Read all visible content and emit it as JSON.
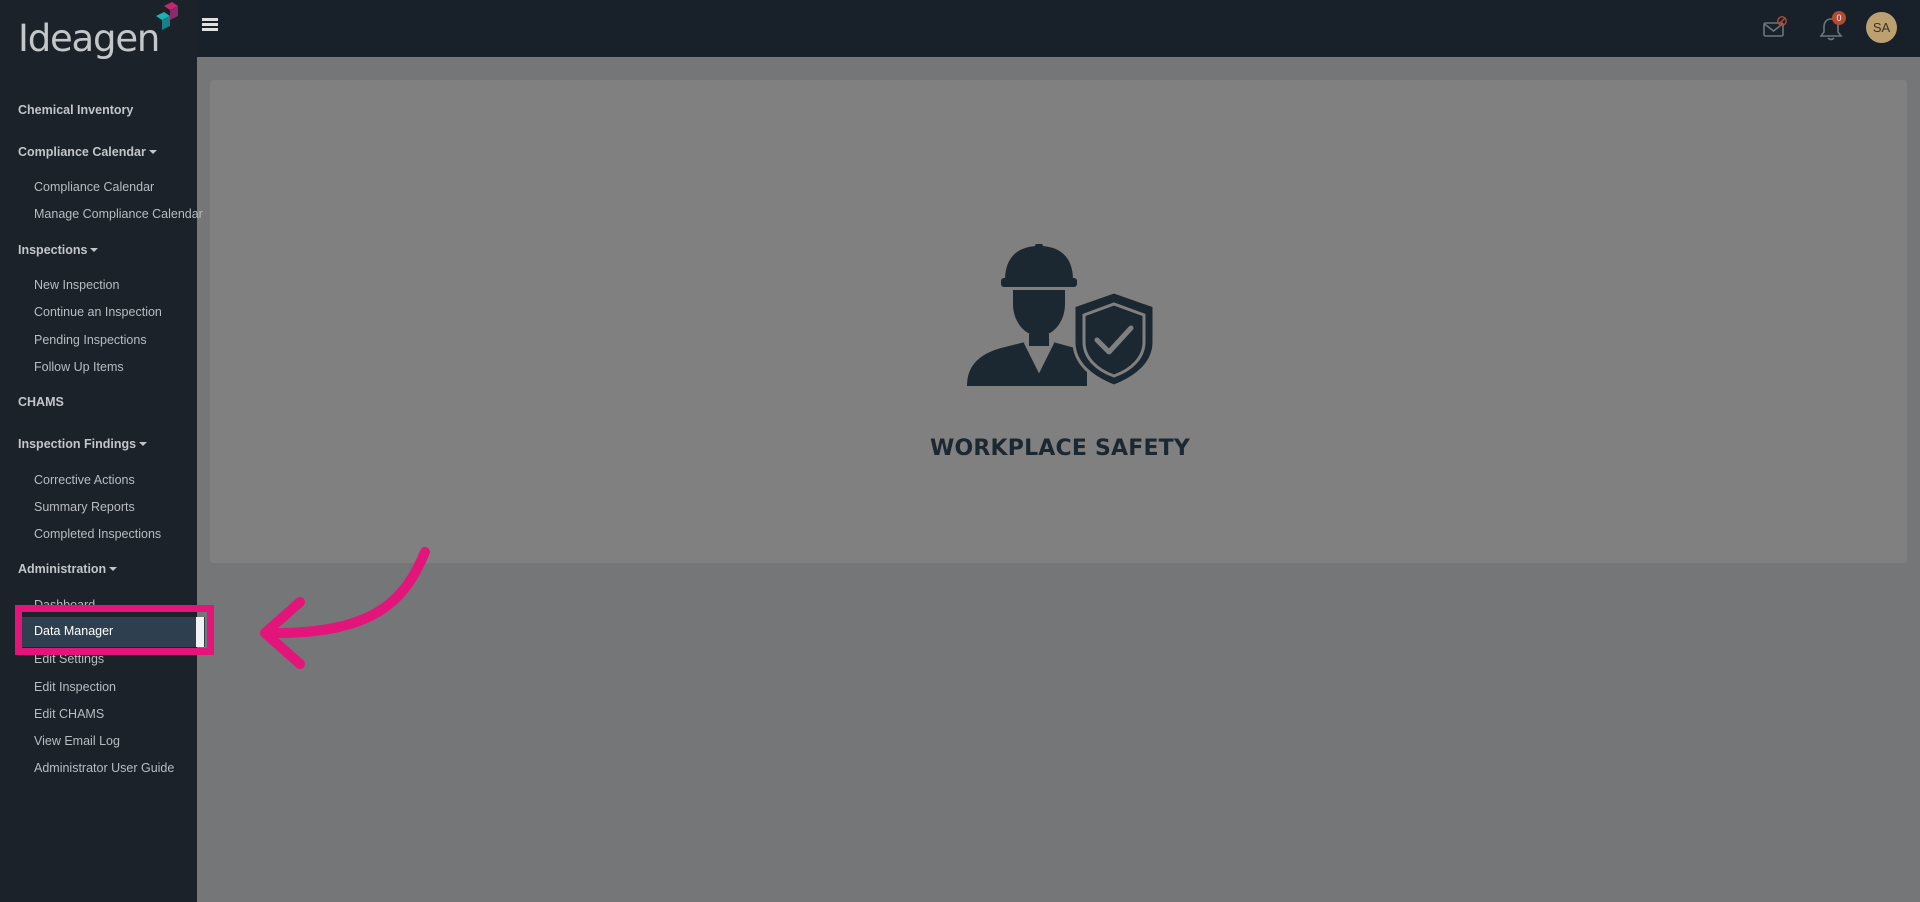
{
  "brand": {
    "logo_text": "Ideagen"
  },
  "sidebar": {
    "groups": [
      {
        "label": "Chemical Inventory",
        "has_caret": false
      },
      {
        "label": "Compliance Calendar",
        "has_caret": true,
        "items": [
          "Compliance Calendar",
          "Manage Compliance Calendar"
        ]
      },
      {
        "label": "Inspections",
        "has_caret": true,
        "items": [
          "New Inspection",
          "Continue an Inspection",
          "Pending Inspections",
          "Follow Up Items"
        ]
      },
      {
        "label": "CHAMS",
        "has_caret": false
      },
      {
        "label": "Inspection Findings",
        "has_caret": true,
        "items": [
          "Corrective Actions",
          "Summary Reports",
          "Completed Inspections"
        ]
      },
      {
        "label": "Administration",
        "has_caret": true,
        "items": [
          "Dashboard",
          "Data Manager",
          "Edit Settings",
          "Edit Inspection",
          "Edit CHAMS",
          "View Email Log",
          "Administrator User Guide"
        ]
      }
    ],
    "active_item": "Data Manager"
  },
  "topbar": {
    "notification_count": "0",
    "avatar_initials": "SA"
  },
  "main": {
    "title": "WORKPLACE SAFETY",
    "icon": "worker-shield-icon"
  },
  "colors": {
    "sidebar_bg": "#1b2229",
    "topbar_bg": "#18212a",
    "overlay_bg": "#757678",
    "card_bg": "#808080",
    "highlight": "#e3157a",
    "active_item_bg": "#2e3f4f"
  }
}
